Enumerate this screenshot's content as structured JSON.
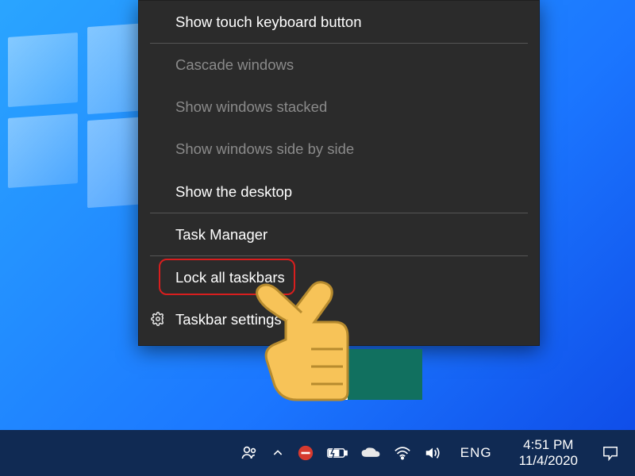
{
  "context_menu": {
    "items": [
      {
        "label": "Show touch keyboard button",
        "enabled": true,
        "separator_after": true
      },
      {
        "label": "Cascade windows",
        "enabled": false
      },
      {
        "label": "Show windows stacked",
        "enabled": false
      },
      {
        "label": "Show windows side by side",
        "enabled": false
      },
      {
        "label": "Show the desktop",
        "enabled": true,
        "separator_after": true
      },
      {
        "label": "Task Manager",
        "enabled": true,
        "separator_after": true,
        "highlighted": true
      },
      {
        "label": "Lock all taskbars",
        "enabled": true
      },
      {
        "label": "Taskbar settings",
        "enabled": true,
        "icon": "gear-icon"
      }
    ]
  },
  "annotation": {
    "highlight_target": "Task Manager",
    "highlight_color": "#d81e1e",
    "pointer_cuff_color": "#11705f",
    "pointer_hand_color": "#f7c358"
  },
  "taskbar": {
    "tray_icons": [
      "people-icon",
      "chevron-up-icon",
      "blocked-icon",
      "battery-icon",
      "onedrive-icon",
      "wifi-icon",
      "volume-icon"
    ],
    "language": "ENG",
    "time": "4:51 PM",
    "date": "11/4/2020"
  }
}
